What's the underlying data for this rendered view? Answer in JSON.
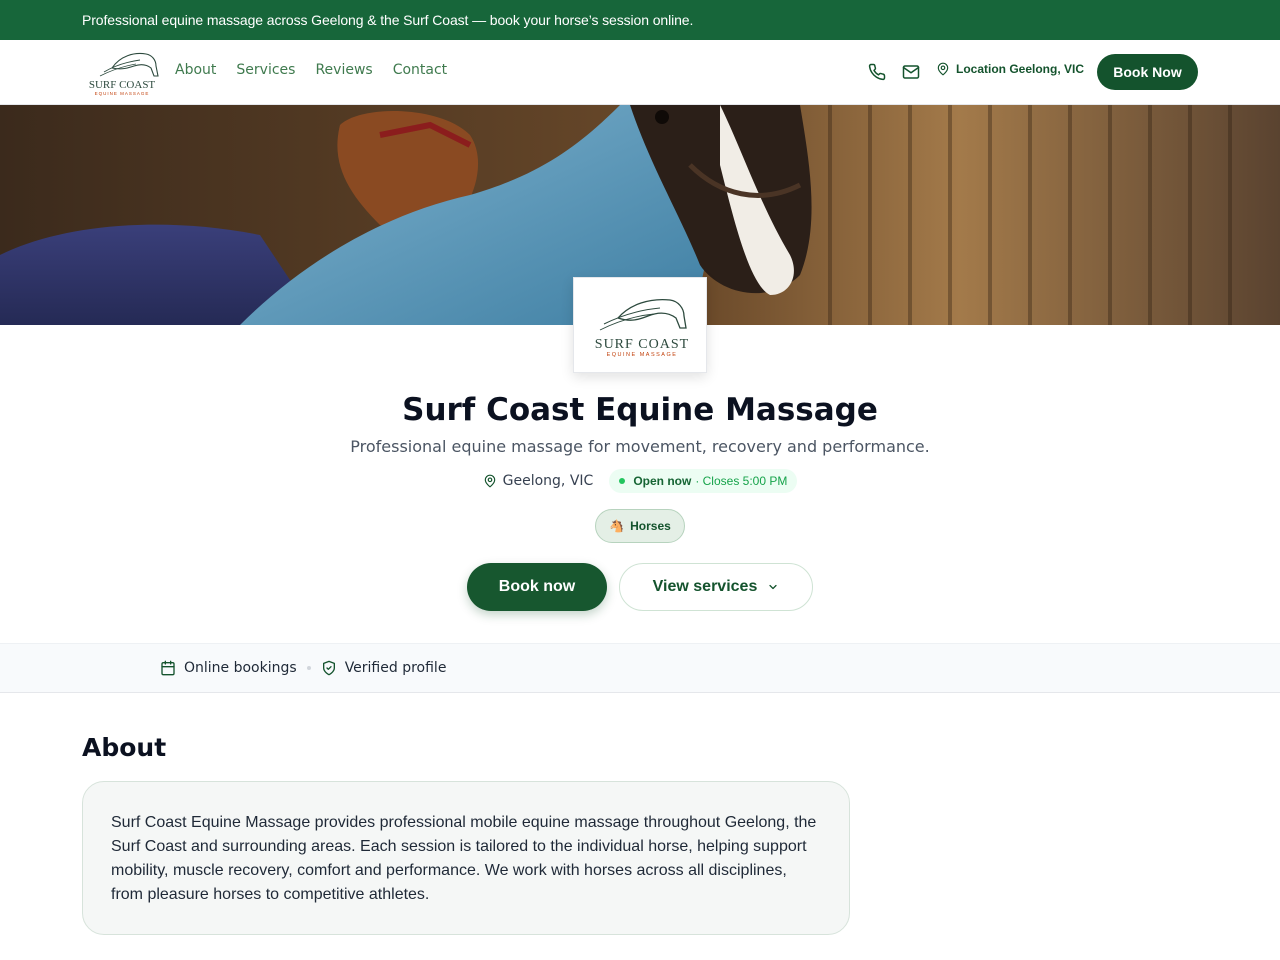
{
  "announcement": "Professional equine massage across Geelong & the Surf Coast — book your horse’s session online.",
  "brand": {
    "logo_line1": "SURF COAST",
    "logo_line2": "EQUINE MASSAGE"
  },
  "nav": {
    "links": [
      "About",
      "Services",
      "Reviews",
      "Contact"
    ],
    "phone_icon": "phone-icon",
    "mail_icon": "mail-icon",
    "location_label": "Location Geelong, VIC",
    "book_label": "Book Now"
  },
  "profile": {
    "name": "Surf Coast Equine Massage",
    "tagline": "Professional equine massage for movement, recovery and performance.",
    "location": "Geelong, VIC",
    "open_status": "Open now",
    "closes": "· Closes 5:00 PM",
    "tag": "Horses",
    "tag_icon": "🐴",
    "primary_cta": "Book now",
    "secondary_cta": "View services"
  },
  "trust": {
    "items": [
      "Online bookings",
      "Verified profile"
    ]
  },
  "about": {
    "heading": "About",
    "body": "Surf Coast Equine Massage provides professional mobile equine massage throughout Geelong, the Surf Coast and surrounding areas. Each session is tailored to the individual horse, helping support mobility, muscle recovery, comfort and performance. We work with horses across all disciplines, from pleasure horses to competitive athletes."
  },
  "colors": {
    "brand_green": "#17663a",
    "dark_green": "#14532d",
    "open_green": "#22c55e"
  }
}
